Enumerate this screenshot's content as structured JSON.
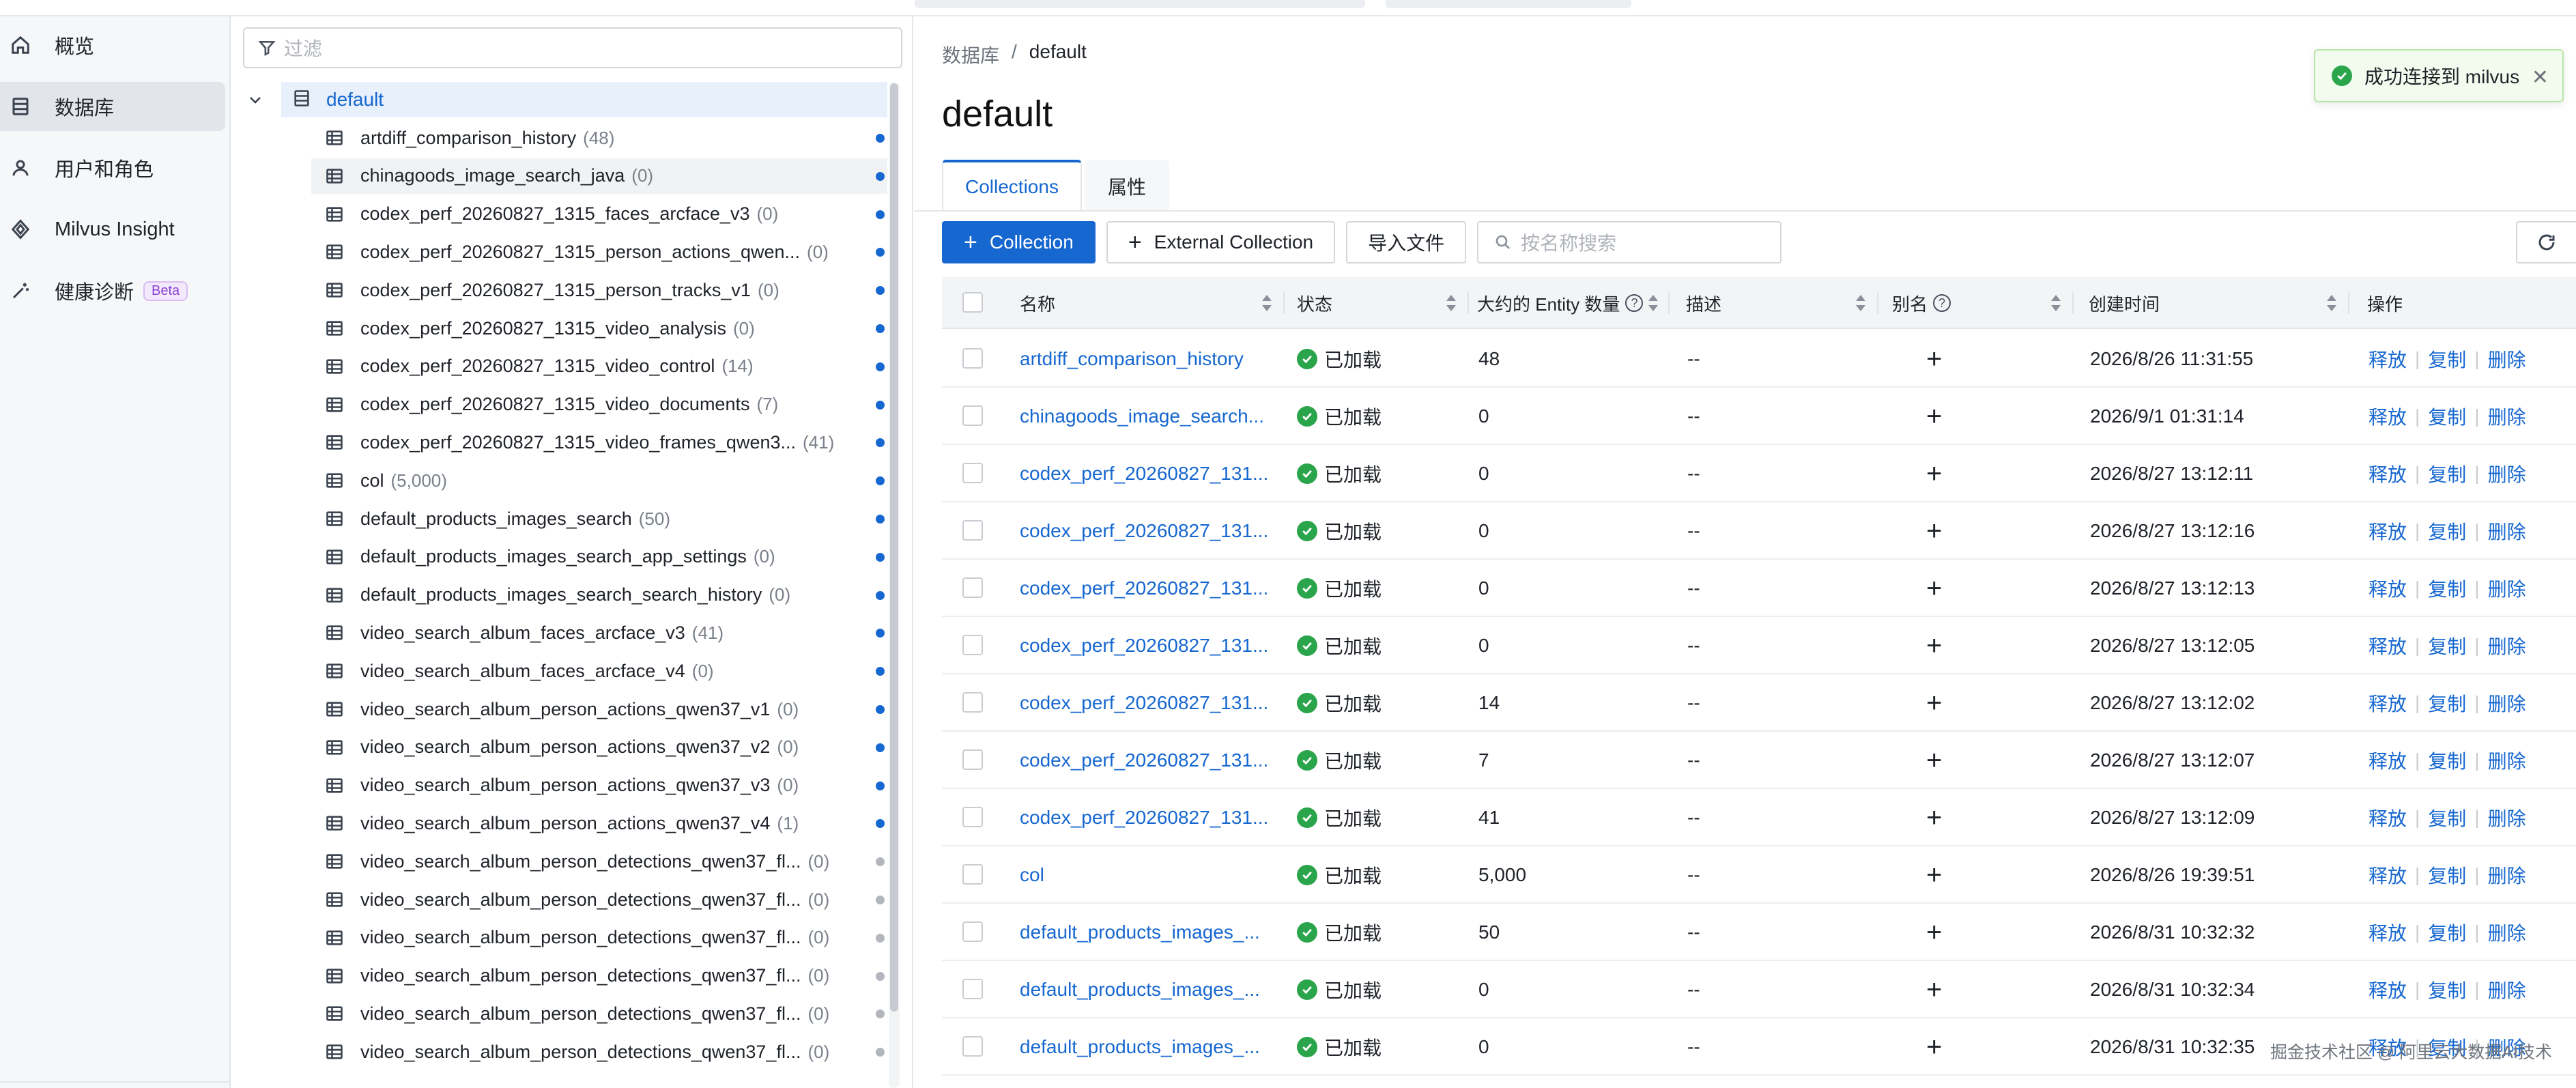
{
  "nav": {
    "items": [
      {
        "label": "概览",
        "icon": "home-icon",
        "active": false
      },
      {
        "label": "数据库",
        "icon": "database-icon",
        "active": true
      },
      {
        "label": "用户和角色",
        "icon": "user-icon",
        "active": false
      },
      {
        "label": "Milvus Insight",
        "icon": "insight-icon",
        "active": false
      },
      {
        "label": "健康诊断",
        "icon": "wand-icon",
        "active": false,
        "badge": "Beta"
      }
    ]
  },
  "tree": {
    "filter_placeholder": "过滤",
    "database": "default",
    "collections": [
      {
        "name": "artdiff_comparison_history",
        "count": "(48)",
        "loaded": true
      },
      {
        "name": "chinagoods_image_search_java",
        "count": "(0)",
        "loaded": true
      },
      {
        "name": "codex_perf_20260827_1315_faces_arcface_v3",
        "count": "(0)",
        "loaded": true
      },
      {
        "name": "codex_perf_20260827_1315_person_actions_qwen...",
        "count": "(0)",
        "loaded": true
      },
      {
        "name": "codex_perf_20260827_1315_person_tracks_v1",
        "count": "(0)",
        "loaded": true
      },
      {
        "name": "codex_perf_20260827_1315_video_analysis",
        "count": "(0)",
        "loaded": true
      },
      {
        "name": "codex_perf_20260827_1315_video_control",
        "count": "(14)",
        "loaded": true
      },
      {
        "name": "codex_perf_20260827_1315_video_documents",
        "count": "(7)",
        "loaded": true
      },
      {
        "name": "codex_perf_20260827_1315_video_frames_qwen3...",
        "count": "(41)",
        "loaded": true
      },
      {
        "name": "col",
        "count": "(5,000)",
        "loaded": true
      },
      {
        "name": "default_products_images_search",
        "count": "(50)",
        "loaded": true
      },
      {
        "name": "default_products_images_search_app_settings",
        "count": "(0)",
        "loaded": true
      },
      {
        "name": "default_products_images_search_search_history",
        "count": "(0)",
        "loaded": true
      },
      {
        "name": "video_search_album_faces_arcface_v3",
        "count": "(41)",
        "loaded": true
      },
      {
        "name": "video_search_album_faces_arcface_v4",
        "count": "(0)",
        "loaded": true
      },
      {
        "name": "video_search_album_person_actions_qwen37_v1",
        "count": "(0)",
        "loaded": true
      },
      {
        "name": "video_search_album_person_actions_qwen37_v2",
        "count": "(0)",
        "loaded": true
      },
      {
        "name": "video_search_album_person_actions_qwen37_v3",
        "count": "(0)",
        "loaded": true
      },
      {
        "name": "video_search_album_person_actions_qwen37_v4",
        "count": "(1)",
        "loaded": true
      },
      {
        "name": "video_search_album_person_detections_qwen37_fl...",
        "count": "(0)",
        "loaded": false
      },
      {
        "name": "video_search_album_person_detections_qwen37_fl...",
        "count": "(0)",
        "loaded": false
      },
      {
        "name": "video_search_album_person_detections_qwen37_fl...",
        "count": "(0)",
        "loaded": false
      },
      {
        "name": "video_search_album_person_detections_qwen37_fl...",
        "count": "(0)",
        "loaded": false
      },
      {
        "name": "video_search_album_person_detections_qwen37_fl...",
        "count": "(0)",
        "loaded": false
      },
      {
        "name": "video_search_album_person_detections_qwen37_fl...",
        "count": "(0)",
        "loaded": false
      }
    ]
  },
  "main": {
    "breadcrumb": {
      "root": "数据库",
      "sep": "/",
      "current": "default"
    },
    "title": "default",
    "tabs": [
      {
        "label": "Collections",
        "active": true
      },
      {
        "label": "属性",
        "active": false
      }
    ],
    "toolbar": {
      "create_label": "Collection",
      "external_label": "External Collection",
      "import_label": "导入文件",
      "search_placeholder": "按名称搜索"
    },
    "table": {
      "headers": {
        "name": "名称",
        "status": "状态",
        "entity": "大约的 Entity 数量",
        "desc": "描述",
        "alias": "别名",
        "created": "创建时间",
        "actions": "操作"
      },
      "actions": [
        "释放",
        "复制",
        "删除"
      ],
      "rows": [
        {
          "name": "artdiff_comparison_history",
          "status": "已加载",
          "entity": "48",
          "desc": "--",
          "created": "2026/8/26 11:31:55"
        },
        {
          "name": "chinagoods_image_search...",
          "status": "已加载",
          "entity": "0",
          "desc": "--",
          "created": "2026/9/1 01:31:14"
        },
        {
          "name": "codex_perf_20260827_131...",
          "status": "已加载",
          "entity": "0",
          "desc": "--",
          "created": "2026/8/27 13:12:11"
        },
        {
          "name": "codex_perf_20260827_131...",
          "status": "已加载",
          "entity": "0",
          "desc": "--",
          "created": "2026/8/27 13:12:16"
        },
        {
          "name": "codex_perf_20260827_131...",
          "status": "已加载",
          "entity": "0",
          "desc": "--",
          "created": "2026/8/27 13:12:13"
        },
        {
          "name": "codex_perf_20260827_131...",
          "status": "已加载",
          "entity": "0",
          "desc": "--",
          "created": "2026/8/27 13:12:05"
        },
        {
          "name": "codex_perf_20260827_131...",
          "status": "已加载",
          "entity": "14",
          "desc": "--",
          "created": "2026/8/27 13:12:02"
        },
        {
          "name": "codex_perf_20260827_131...",
          "status": "已加载",
          "entity": "7",
          "desc": "--",
          "created": "2026/8/27 13:12:07"
        },
        {
          "name": "codex_perf_20260827_131...",
          "status": "已加载",
          "entity": "41",
          "desc": "--",
          "created": "2026/8/27 13:12:09"
        },
        {
          "name": "col",
          "status": "已加载",
          "entity": "5,000",
          "desc": "--",
          "created": "2026/8/26 19:39:51"
        },
        {
          "name": "default_products_images_...",
          "status": "已加载",
          "entity": "50",
          "desc": "--",
          "created": "2026/8/31 10:32:32"
        },
        {
          "name": "default_products_images_...",
          "status": "已加载",
          "entity": "0",
          "desc": "--",
          "created": "2026/8/31 10:32:34"
        },
        {
          "name": "default_products_images_...",
          "status": "已加载",
          "entity": "0",
          "desc": "--",
          "created": "2026/8/31 10:32:35"
        }
      ]
    }
  },
  "toast": {
    "message": "成功连接到 milvus"
  },
  "watermark": "掘金技术社区 @ 阿里云大数据AI技术",
  "colors": {
    "accent": "#1667d0",
    "success": "#2ba54b",
    "unloaded": "#b3b7bd"
  }
}
